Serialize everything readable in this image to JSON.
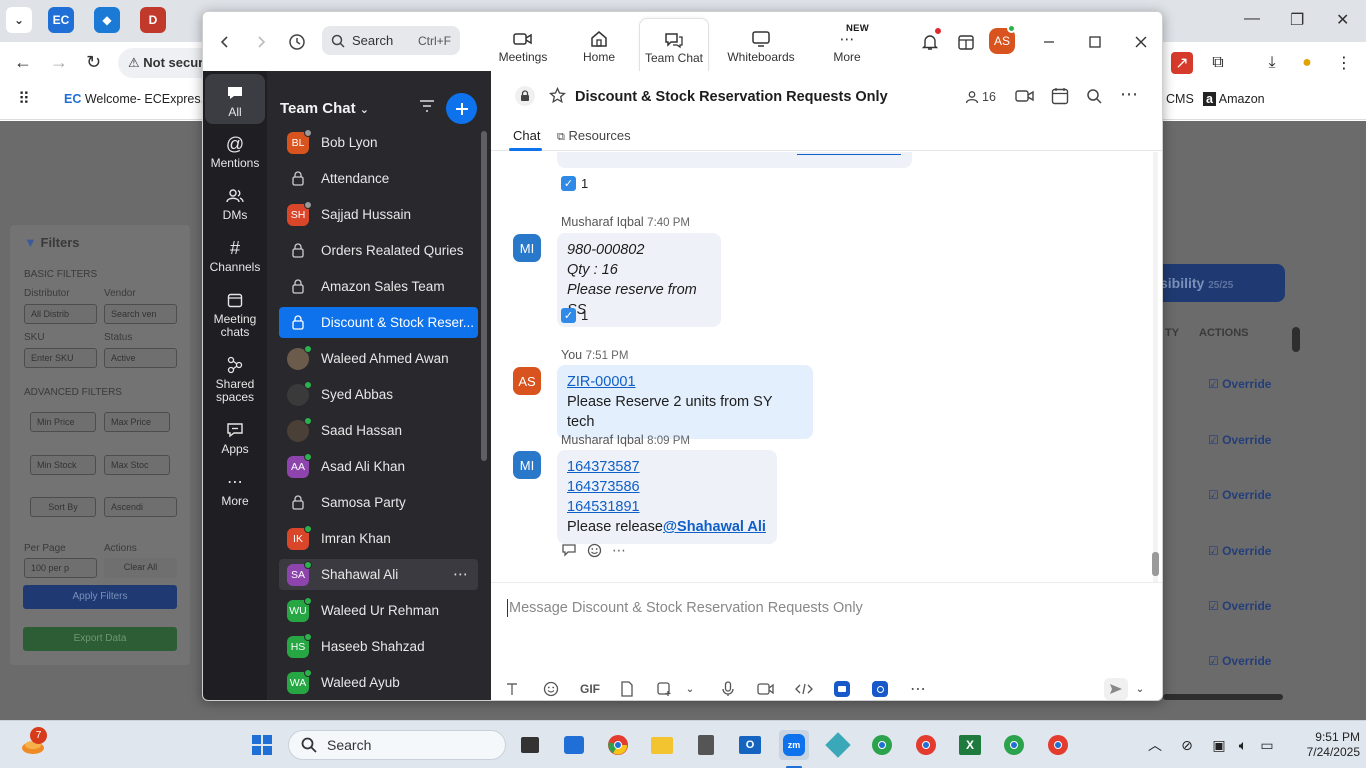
{
  "browser": {
    "omnibox_text": "Not secure",
    "bookmarks": [
      "Welcome- ECExpres...",
      "CMS",
      "Amazon"
    ],
    "filters": {
      "title": "Filters",
      "basic_label": "BASIC FILTERS",
      "distributor_label": "Distributor",
      "distributor_value": "All Distrib",
      "vendor_label": "Vendor",
      "vendor_placeholder": "Search ven",
      "sku_label": "SKU",
      "sku_placeholder": "Enter SKU",
      "status_label": "Status",
      "status_value": "Active",
      "advanced_label": "ADVANCED FILTERS",
      "min_price": "Min Price",
      "max_price": "Max Price",
      "min_stock": "Min Stock",
      "max_stock": "Max Stoc",
      "sort_by": "Sort By",
      "order": "Ascendi",
      "per_page_label": "Per Page",
      "per_page_value": "100 per p",
      "actions_label": "Actions",
      "clear_all": "Clear All",
      "apply": "Apply Filters",
      "export": "Export Data"
    },
    "visibility_pill": "sibility",
    "visibility_count": "25/25",
    "col_ty": "TY",
    "col_actions": "ACTIONS",
    "override_label": "Override"
  },
  "zoom": {
    "search": {
      "label": "Search",
      "shortcut": "Ctrl+F"
    },
    "nav": {
      "meetings": "Meetings",
      "home": "Home",
      "team_chat": "Team Chat",
      "whiteboards": "Whiteboards",
      "more": "More",
      "new_badge": "NEW"
    },
    "user_initials": "AS",
    "rail": {
      "all": "All",
      "mentions": "Mentions",
      "dms": "DMs",
      "channels": "Channels",
      "meeting_chats": "Meeting chats",
      "shared_spaces": "Shared spaces",
      "apps": "Apps",
      "more": "More"
    },
    "list": {
      "title": "Team Chat",
      "items": [
        {
          "name": "Bob Lyon",
          "initials": "BL",
          "color": "#d9531e",
          "type": "dm"
        },
        {
          "name": "Attendance",
          "type": "channel"
        },
        {
          "name": "Sajjad Hussain",
          "initials": "SH",
          "color": "#d9462a",
          "type": "dm"
        },
        {
          "name": "Orders Realated Quries",
          "type": "channel"
        },
        {
          "name": "Amazon Sales Team",
          "type": "channel"
        },
        {
          "name": "Discount & Stock Reser...",
          "type": "channel"
        },
        {
          "name": "Waleed Ahmed Awan",
          "initials": "",
          "color": "#6b5b4b",
          "type": "photo"
        },
        {
          "name": "Syed Abbas",
          "initials": "",
          "color": "#3a3a3a",
          "type": "photo"
        },
        {
          "name": "Saad Hassan",
          "initials": "",
          "color": "#4a4038",
          "type": "photo"
        },
        {
          "name": "Asad Ali Khan",
          "initials": "AA",
          "color": "#8e44ad",
          "type": "dm"
        },
        {
          "name": "Samosa Party",
          "type": "channel"
        },
        {
          "name": "Imran Khan",
          "initials": "IK",
          "color": "#d9462a",
          "type": "dm"
        },
        {
          "name": "Shahawal Ali",
          "initials": "SA",
          "color": "#8e44ad",
          "type": "dm"
        },
        {
          "name": "Waleed Ur Rehman",
          "initials": "WU",
          "color": "#27a644",
          "type": "dm"
        },
        {
          "name": "Haseeb Shahzad",
          "initials": "HS",
          "color": "#27a644",
          "type": "dm"
        },
        {
          "name": "Waleed Ayub",
          "initials": "WA",
          "color": "#27a644",
          "type": "dm"
        }
      ]
    },
    "chat": {
      "title": "Discount & Stock Reservation Requests Only",
      "member_count": "16",
      "tab_chat": "Chat",
      "tab_resources": "Resources",
      "messages": [
        {
          "sender": "Musharaf Iqbal",
          "time": "7:40 PM",
          "initials": "MI",
          "lines": [
            "980-000802",
            "Qty : 16",
            "Please reserve from SS"
          ],
          "reaction_count": "1"
        },
        {
          "sender": "You",
          "time": "7:51 PM",
          "initials": "AS",
          "link": "ZIR-00001",
          "line": "Please Reserve 2 units from SY tech"
        },
        {
          "sender": "Musharaf Iqbal",
          "time": "8:09 PM",
          "initials": "MI",
          "links": [
            "164373587",
            "164373586",
            "164531891"
          ],
          "text": "Please release",
          "mention": "@Shahawal Ali"
        }
      ],
      "prev_reaction_count": "1",
      "composer_placeholder": "Message Discount & Stock Reservation Requests Only",
      "gif_label": "GIF"
    }
  },
  "taskbar": {
    "search_label": "Search",
    "time": "9:51 PM",
    "date": "7/24/2025",
    "badge_count": "7"
  }
}
